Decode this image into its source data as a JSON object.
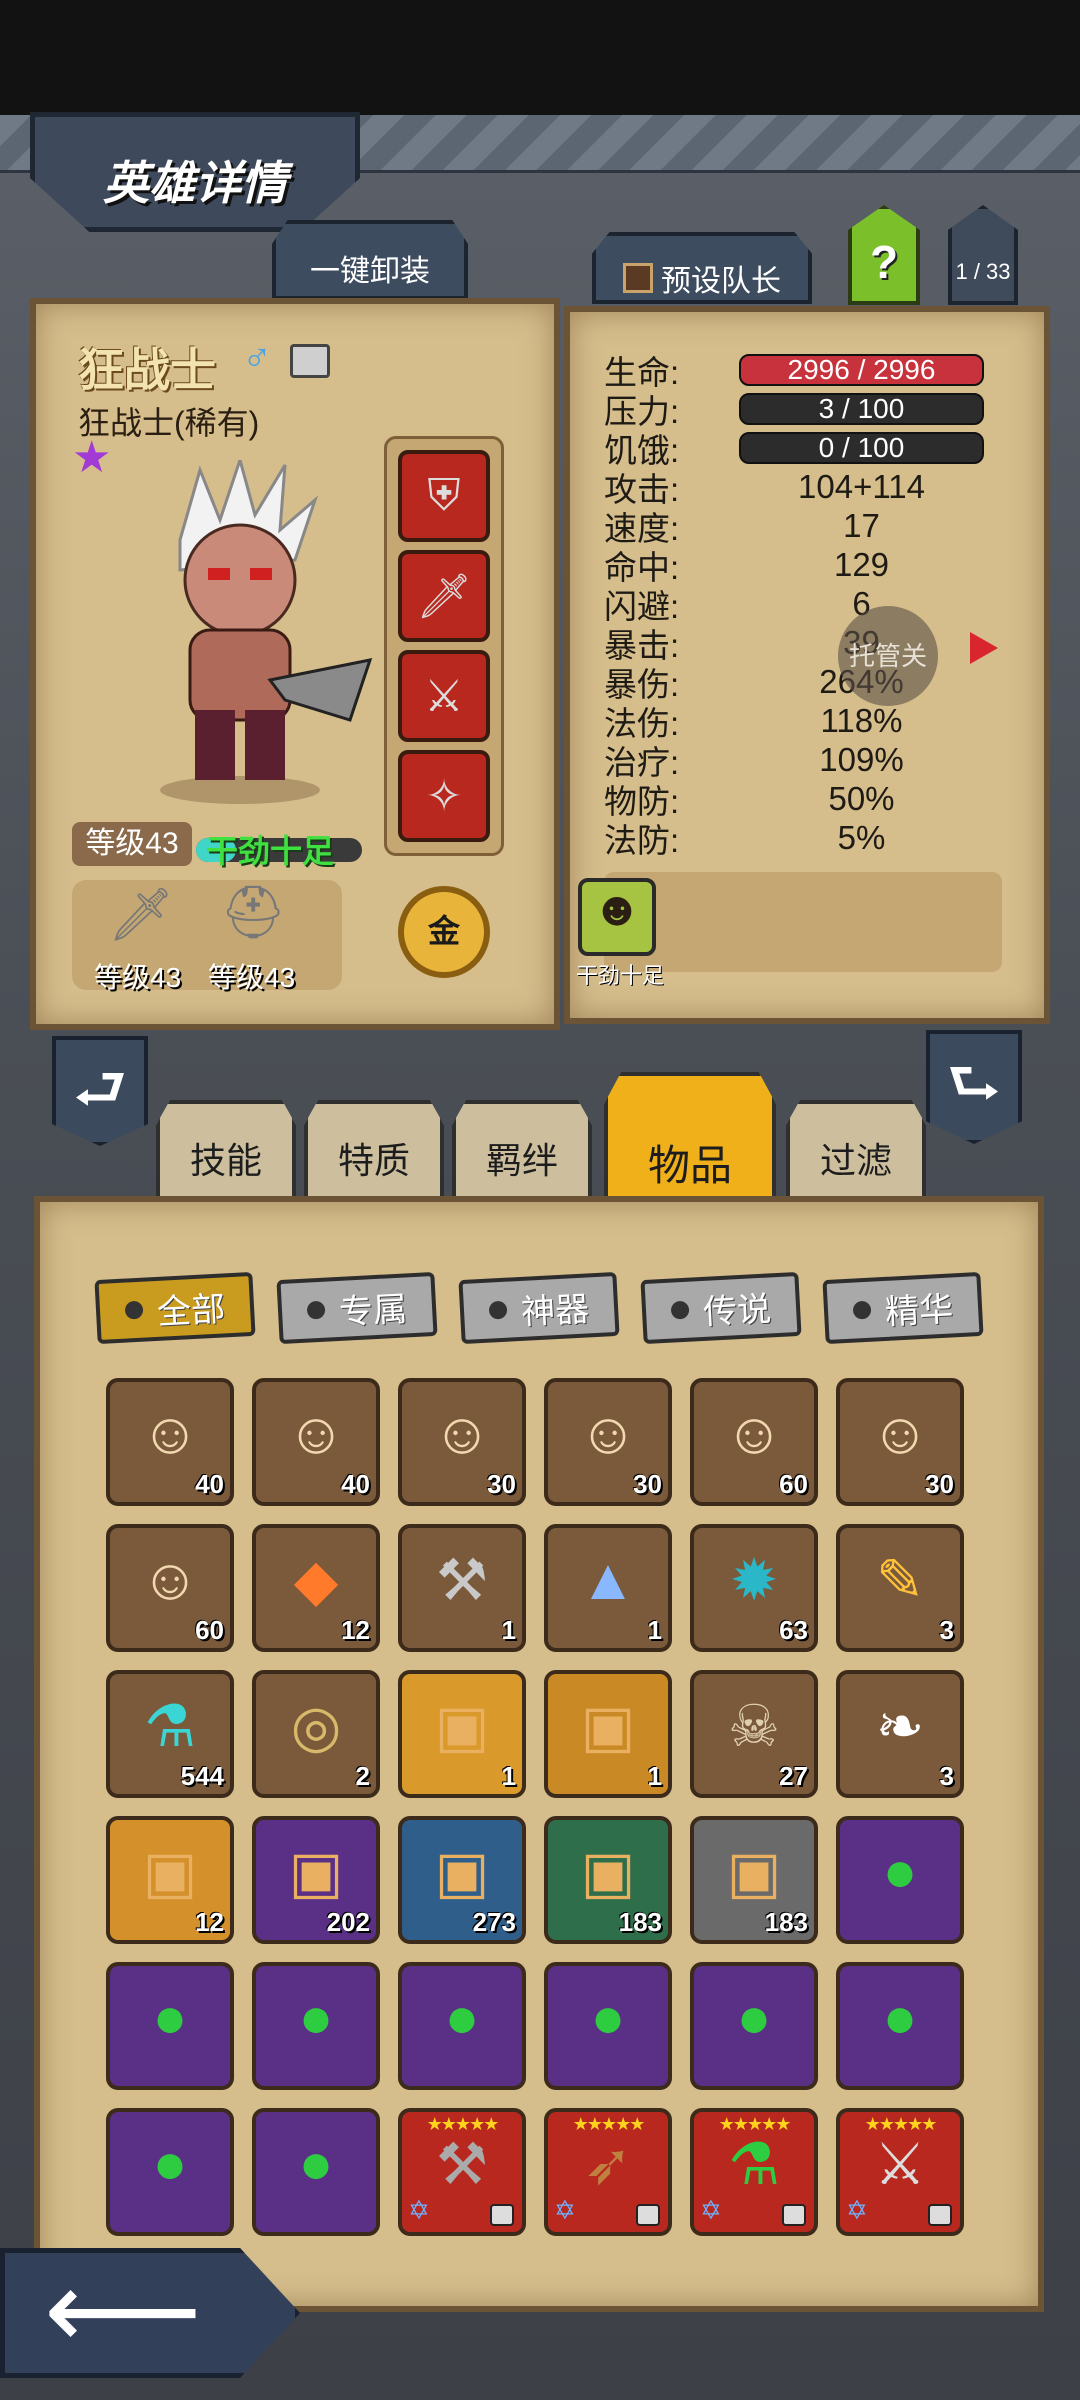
{
  "header": {
    "title": "英雄详情",
    "unequip_all": "一键卸装",
    "preset_captain": "预设队长",
    "help": "?",
    "page": "1 / 33"
  },
  "hero": {
    "name": "狂战士",
    "subtitle": "狂战士(稀有)",
    "gender": "♂",
    "level": "等级43",
    "mood": "干劲十足",
    "weapon_level": "等级43",
    "armor_level": "等级43",
    "gold_label": "金",
    "buff_label": "干劲十足"
  },
  "stats": [
    {
      "label": "生命:",
      "value": "2996 / 2996",
      "type": "bar",
      "color": "#c8323c"
    },
    {
      "label": "压力:",
      "value": "3 / 100",
      "type": "bar",
      "color": "#2c2c2c"
    },
    {
      "label": "饥饿:",
      "value": "0 / 100",
      "type": "bar",
      "color": "#2c2c2c"
    },
    {
      "label": "攻击:",
      "value": "104+114"
    },
    {
      "label": "速度:",
      "value": "17"
    },
    {
      "label": "命中:",
      "value": "129"
    },
    {
      "label": "闪避:",
      "value": "6"
    },
    {
      "label": "暴击:",
      "value": "39"
    },
    {
      "label": "暴伤:",
      "value": "264%"
    },
    {
      "label": "法伤:",
      "value": "118%"
    },
    {
      "label": "治疗:",
      "value": "109%"
    },
    {
      "label": "物防:",
      "value": "50%"
    },
    {
      "label": "法防:",
      "value": "5%"
    }
  ],
  "auto_manage": "托管关",
  "tabs": [
    {
      "label": "技能"
    },
    {
      "label": "特质"
    },
    {
      "label": "羁绊"
    },
    {
      "label": "物品"
    },
    {
      "label": "过滤"
    }
  ],
  "filters": [
    {
      "label": "全部"
    },
    {
      "label": "专属"
    },
    {
      "label": "神器"
    },
    {
      "label": "传说"
    },
    {
      "label": "精华"
    }
  ],
  "items": [
    {
      "icon": "portrait",
      "count": "40",
      "bg": "#7a5a3a"
    },
    {
      "icon": "portrait",
      "count": "40",
      "bg": "#7a5a3a"
    },
    {
      "icon": "portrait",
      "count": "30",
      "bg": "#7a5a3a"
    },
    {
      "icon": "portrait",
      "count": "30",
      "bg": "#7a5a3a"
    },
    {
      "icon": "portrait",
      "count": "60",
      "bg": "#7a5a3a"
    },
    {
      "icon": "portrait",
      "count": "30",
      "bg": "#7a5a3a"
    },
    {
      "icon": "portrait",
      "count": "60",
      "bg": "#7a5a3a"
    },
    {
      "icon": "gem",
      "count": "12",
      "bg": "#7a5a3a"
    },
    {
      "icon": "chisel",
      "count": "1",
      "bg": "#7a5a3a"
    },
    {
      "icon": "crystal-pile",
      "count": "1",
      "bg": "#7a5a3a"
    },
    {
      "icon": "rune",
      "count": "63",
      "bg": "#7a5a3a"
    },
    {
      "icon": "feather-gold",
      "count": "3",
      "bg": "#7a5a3a"
    },
    {
      "icon": "potion",
      "count": "544",
      "bg": "#7a5a3a"
    },
    {
      "icon": "scroll",
      "count": "2",
      "bg": "#7a5a3a"
    },
    {
      "icon": "chest",
      "count": "1",
      "bg": "#d99a2b"
    },
    {
      "icon": "chest",
      "count": "1",
      "bg": "#c98a25"
    },
    {
      "icon": "skull",
      "count": "27",
      "bg": "#7a5a3a"
    },
    {
      "icon": "feather",
      "count": "3",
      "bg": "#7a5a3a"
    },
    {
      "icon": "chest",
      "count": "12",
      "bg": "#d4902a"
    },
    {
      "icon": "chest",
      "count": "202",
      "bg": "#5a2f86"
    },
    {
      "icon": "chest",
      "count": "273",
      "bg": "#2f5e8a"
    },
    {
      "icon": "chest",
      "count": "183",
      "bg": "#2f6e4a"
    },
    {
      "icon": "chest",
      "count": "183",
      "bg": "#6a6a6a"
    },
    {
      "icon": "green-orb",
      "count": "",
      "bg": "#5a2f86"
    },
    {
      "icon": "green-orb",
      "count": "",
      "bg": "#5a2f86"
    },
    {
      "icon": "green-orb",
      "count": "",
      "bg": "#5a2f86"
    },
    {
      "icon": "green-orb",
      "count": "",
      "bg": "#5a2f86"
    },
    {
      "icon": "green-orb",
      "count": "",
      "bg": "#5a2f86"
    },
    {
      "icon": "green-orb",
      "count": "",
      "bg": "#5a2f86"
    },
    {
      "icon": "green-orb",
      "count": "",
      "bg": "#5a2f86"
    },
    {
      "icon": "green-orb",
      "count": "",
      "bg": "#5a2f86"
    },
    {
      "icon": "green-orb",
      "count": "",
      "bg": "#5a2f86"
    },
    {
      "icon": "axe",
      "count": "",
      "bg": "#b8281f",
      "stars": "★★★★★"
    },
    {
      "icon": "crossbow",
      "count": "",
      "bg": "#b8281f",
      "stars": "★★★★★"
    },
    {
      "icon": "flask",
      "count": "",
      "bg": "#b8281f",
      "stars": "★★★★★"
    },
    {
      "icon": "battleaxe",
      "count": "",
      "bg": "#b8281f",
      "stars": "★★★★★"
    }
  ]
}
